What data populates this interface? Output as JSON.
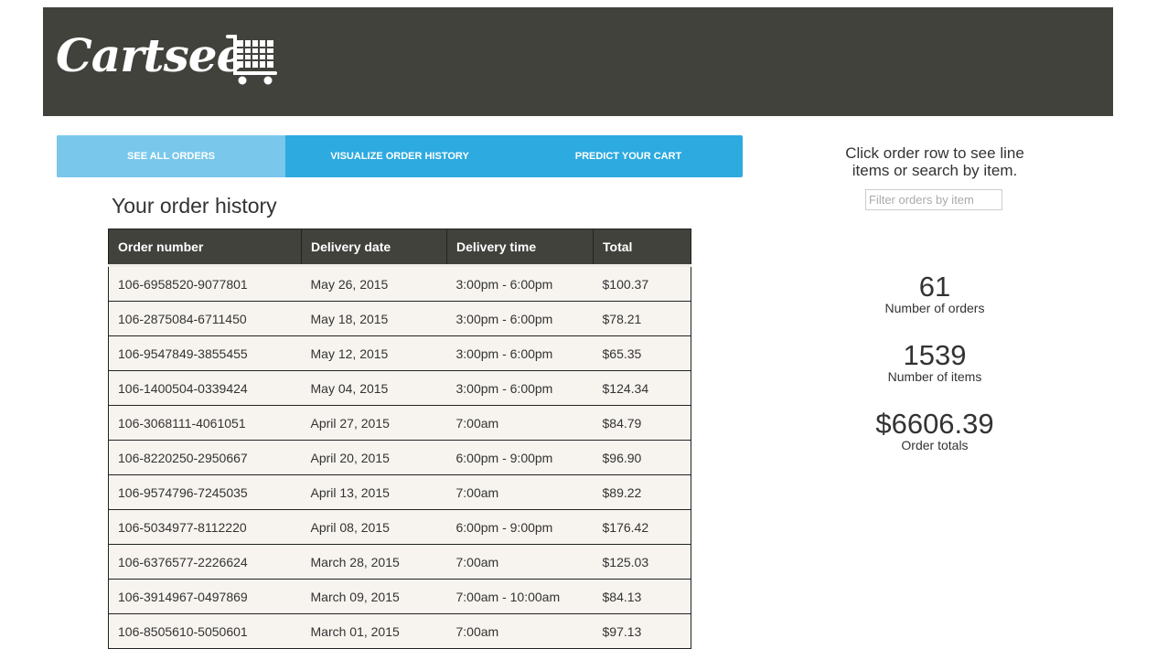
{
  "brand": {
    "logo_text": "Cartsee",
    "icon": "shopping-cart-icon"
  },
  "tabs": [
    {
      "label": "SEE ALL ORDERS",
      "active": true
    },
    {
      "label": "VISUALIZE ORDER HISTORY",
      "active": false
    },
    {
      "label": "PREDICT YOUR CART",
      "active": false
    }
  ],
  "main": {
    "title": "Your order history"
  },
  "table": {
    "headers": [
      "Order number",
      "Delivery date",
      "Delivery time",
      "Total"
    ],
    "rows": [
      [
        "106-6958520-9077801",
        "May 26, 2015",
        "3:00pm - 6:00pm",
        "$100.37"
      ],
      [
        "106-2875084-6711450",
        "May 18, 2015",
        "3:00pm - 6:00pm",
        "$78.21"
      ],
      [
        "106-9547849-3855455",
        "May 12, 2015",
        "3:00pm - 6:00pm",
        "$65.35"
      ],
      [
        "106-1400504-0339424",
        "May 04, 2015",
        "3:00pm - 6:00pm",
        "$124.34"
      ],
      [
        "106-3068111-4061051",
        "April 27, 2015",
        "7:00am",
        "$84.79"
      ],
      [
        "106-8220250-2950667",
        "April 20, 2015",
        "6:00pm - 9:00pm",
        "$96.90"
      ],
      [
        "106-9574796-7245035",
        "April 13, 2015",
        "7:00am",
        "$89.22"
      ],
      [
        "106-5034977-8112220",
        "April 08, 2015",
        "6:00pm - 9:00pm",
        "$176.42"
      ],
      [
        "106-6376577-2226624",
        "March 28, 2015",
        "7:00am",
        "$125.03"
      ],
      [
        "106-3914967-0497869",
        "March 09, 2015",
        "7:00am - 10:00am",
        "$84.13"
      ],
      [
        "106-8505610-5050601",
        "March 01, 2015",
        "7:00am",
        "$97.13"
      ]
    ]
  },
  "sidebar": {
    "instructions": "Click order row to see line items or search by item.",
    "filter_placeholder": "Filter orders by item",
    "stats": [
      {
        "value": "61",
        "label": "Number of orders"
      },
      {
        "value": "1539",
        "label": "Number of items"
      },
      {
        "value": "$6606.39",
        "label": "Order totals"
      }
    ]
  }
}
